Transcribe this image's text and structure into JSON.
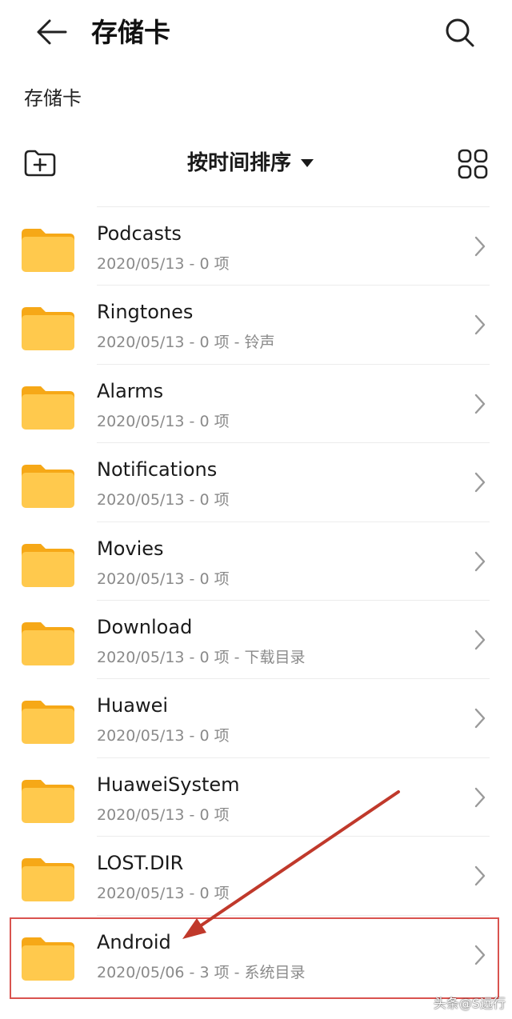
{
  "header": {
    "title": "存储卡",
    "back_icon": "arrow-left-icon",
    "search_icon": "search-icon"
  },
  "breadcrumb": "存储卡",
  "toolbar": {
    "new_folder_icon": "folder-add-icon",
    "sort_label": "按时间排序",
    "view_icon": "grid-view-icon"
  },
  "folders": [
    {
      "name": "Podcasts",
      "meta": "2020/05/13 - 0 项"
    },
    {
      "name": "Ringtones",
      "meta": "2020/05/13 - 0 项 - 铃声"
    },
    {
      "name": "Alarms",
      "meta": "2020/05/13 - 0 项"
    },
    {
      "name": "Notifications",
      "meta": "2020/05/13 - 0 项"
    },
    {
      "name": "Movies",
      "meta": "2020/05/13 - 0 项"
    },
    {
      "name": "Download",
      "meta": "2020/05/13 - 0 项 - 下载目录"
    },
    {
      "name": "Huawei",
      "meta": "2020/05/13 - 0 项"
    },
    {
      "name": "HuaweiSystem",
      "meta": "2020/05/13 - 0 项"
    },
    {
      "name": "LOST.DIR",
      "meta": "2020/05/13 - 0 项"
    },
    {
      "name": "Android",
      "meta": "2020/05/06 - 3 项 - 系统目录"
    }
  ],
  "colors": {
    "folder": "#ffc94d",
    "folder_tab": "#f6a817",
    "annotation": "#d9534f",
    "text_secondary": "#8a8a8a"
  },
  "watermark": "头条@S远行"
}
